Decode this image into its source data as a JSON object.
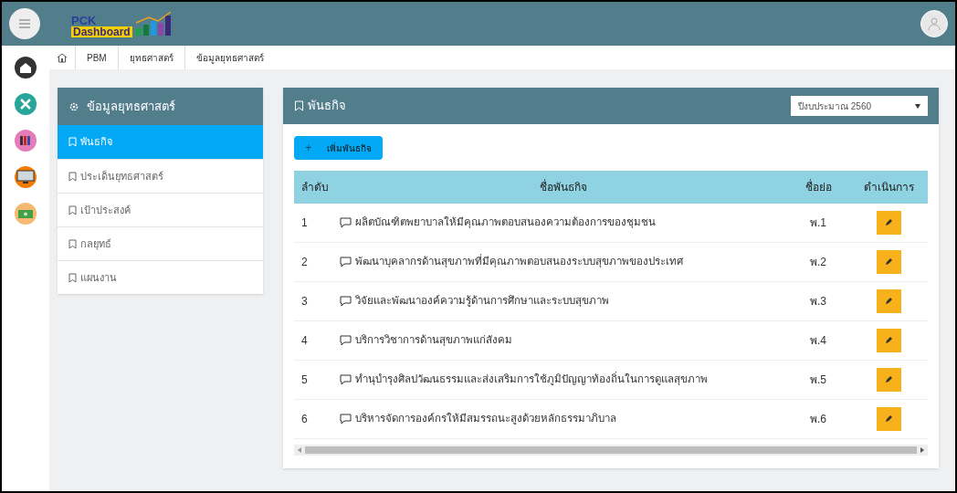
{
  "logo": {
    "line_1": "PCK",
    "line_2": "Dashboard"
  },
  "breadcrumb": [
    "PBM",
    "ยุทธศาสตร์",
    "ข้อมูลยุทธศาสตร์"
  ],
  "sidebar": {
    "title": "ข้อมูลยุทธศาสตร์",
    "items": [
      {
        "label": "พันธกิจ",
        "selected": true
      },
      {
        "label": "ประเด็นยุทธศาสตร์",
        "selected": false
      },
      {
        "label": "เป้าประสงค์",
        "selected": false
      },
      {
        "label": "กลยุทธ์",
        "selected": false
      },
      {
        "label": "แผนงาน",
        "selected": false
      }
    ]
  },
  "panel": {
    "title": "พันธกิจ",
    "year_select": {
      "value": "ปีงบประมาณ 2560"
    },
    "add_button": {
      "icon": "+",
      "label": "เพิ่มพันธกิจ"
    },
    "table": {
      "columns": [
        "ลำดับ",
        "ชื่อพันธกิจ",
        "ชื่อย่อ",
        "ดำเนินการ"
      ],
      "rows": [
        {
          "no": "1",
          "name": "ผลิตบัณฑิตพยาบาลให้มีคุณภาพตอบสนองความต้องการของชุมชน",
          "short": "พ.1"
        },
        {
          "no": "2",
          "name": "พัฒนาบุคลากรด้านสุขภาพที่มีคุณภาพตอบสนองระบบสุขภาพของประเทศ",
          "short": "พ.2"
        },
        {
          "no": "3",
          "name": "วิจัยและพัฒนาองค์ความรู้ด้านการศึกษาและระบบสุขภาพ",
          "short": "พ.3"
        },
        {
          "no": "4",
          "name": "บริการวิชาการด้านสุขภาพแก่สังคม",
          "short": "พ.4"
        },
        {
          "no": "5",
          "name": "ทำนุบำรุงศิลปวัฒนธรรมและส่งเสริมการใช้ภูมิปัญญาท้องถิ่นในการดูแลสุขภาพ",
          "short": "พ.5"
        },
        {
          "no": "6",
          "name": "บริหารจัดการองค์กรให้มีสมรรถนะสูงด้วยหลักธรรมาภิบาล",
          "short": "พ.6"
        }
      ]
    }
  }
}
